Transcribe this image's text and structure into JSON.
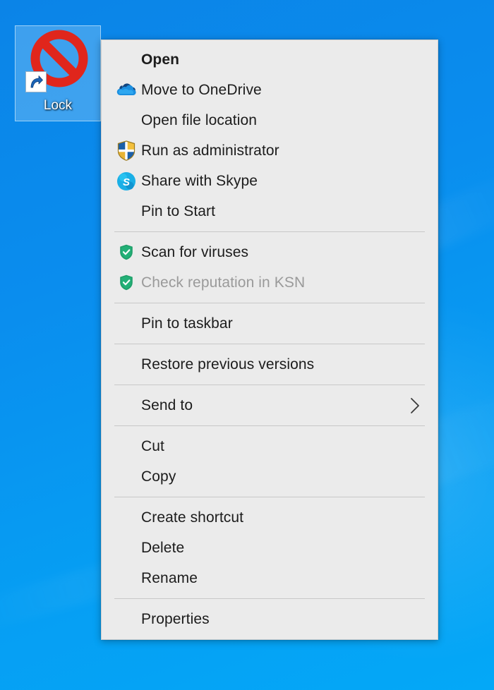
{
  "desktop": {
    "icon": {
      "label": "Lock",
      "icon_name": "no-entry-prohibited-icon",
      "badge_name": "shortcut-arrow-badge",
      "selected": true
    },
    "background_color": "#0c86e8",
    "background_color_bottom": "#04a8f7"
  },
  "context_menu": {
    "groups": [
      {
        "items": [
          {
            "label": "Open",
            "icon": "none",
            "bold": true,
            "disabled": false,
            "submenu": false
          },
          {
            "label": "Move to OneDrive",
            "icon": "onedrive-cloud-icon",
            "bold": false,
            "disabled": false,
            "submenu": false
          },
          {
            "label": "Open file location",
            "icon": "none",
            "bold": false,
            "disabled": false,
            "submenu": false
          },
          {
            "label": "Run as administrator",
            "icon": "uac-shield-icon",
            "bold": false,
            "disabled": false,
            "submenu": false
          },
          {
            "label": "Share with Skype",
            "icon": "skype-icon",
            "bold": false,
            "disabled": false,
            "submenu": false
          },
          {
            "label": "Pin to Start",
            "icon": "none",
            "bold": false,
            "disabled": false,
            "submenu": false
          }
        ]
      },
      {
        "items": [
          {
            "label": "Scan for viruses",
            "icon": "kaspersky-green-shield-icon",
            "bold": false,
            "disabled": false,
            "submenu": false
          },
          {
            "label": "Check reputation in KSN",
            "icon": "kaspersky-green-shield-icon",
            "bold": false,
            "disabled": true,
            "submenu": false
          }
        ]
      },
      {
        "items": [
          {
            "label": "Pin to taskbar",
            "icon": "none",
            "bold": false,
            "disabled": false,
            "submenu": false
          }
        ]
      },
      {
        "items": [
          {
            "label": "Restore previous versions",
            "icon": "none",
            "bold": false,
            "disabled": false,
            "submenu": false
          }
        ]
      },
      {
        "items": [
          {
            "label": "Send to",
            "icon": "none",
            "bold": false,
            "disabled": false,
            "submenu": true
          }
        ]
      },
      {
        "items": [
          {
            "label": "Cut",
            "icon": "none",
            "bold": false,
            "disabled": false,
            "submenu": false
          },
          {
            "label": "Copy",
            "icon": "none",
            "bold": false,
            "disabled": false,
            "submenu": false
          }
        ]
      },
      {
        "items": [
          {
            "label": "Create shortcut",
            "icon": "none",
            "bold": false,
            "disabled": false,
            "submenu": false
          },
          {
            "label": "Delete",
            "icon": "none",
            "bold": false,
            "disabled": false,
            "submenu": false
          },
          {
            "label": "Rename",
            "icon": "none",
            "bold": false,
            "disabled": false,
            "submenu": false
          }
        ]
      },
      {
        "items": [
          {
            "label": "Properties",
            "icon": "none",
            "bold": false,
            "disabled": false,
            "submenu": false
          }
        ]
      }
    ],
    "colors": {
      "background": "#ebebeb",
      "text": "#1c1c1c",
      "disabled_text": "#9a9a9a",
      "separator": "#c8c8c8",
      "border": "#cfcfcf"
    }
  }
}
